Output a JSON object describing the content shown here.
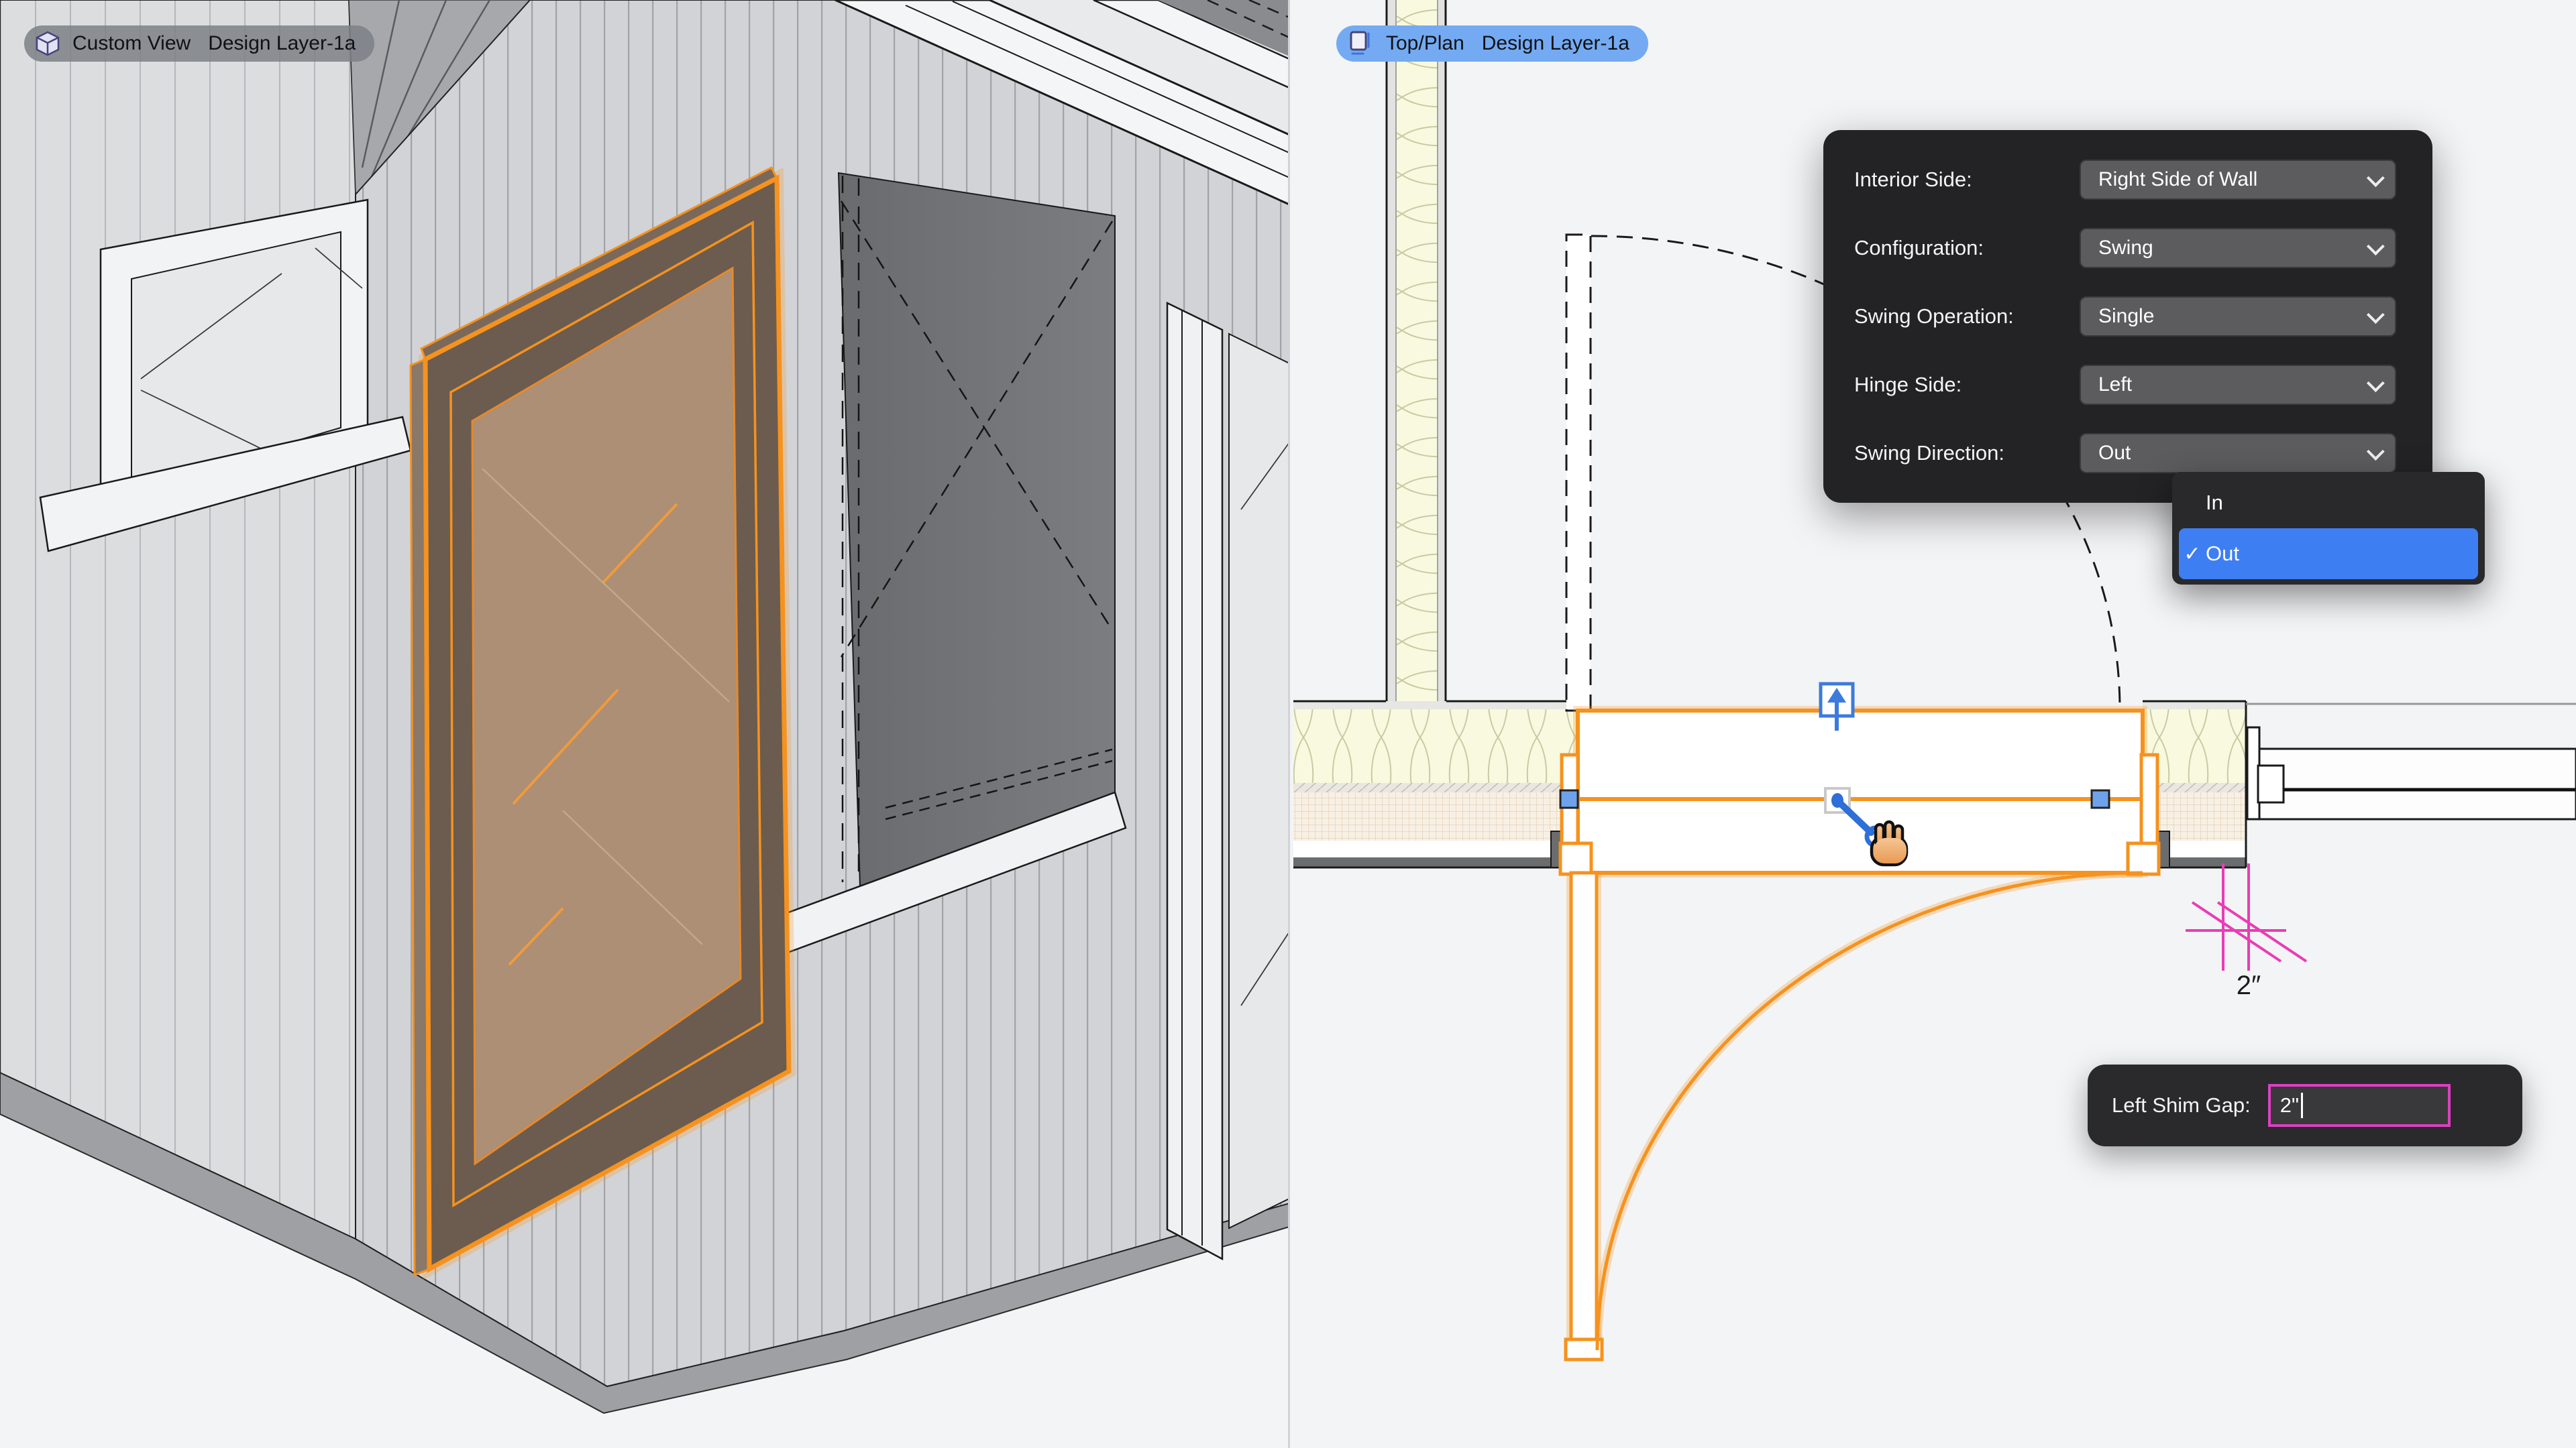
{
  "left_view": {
    "badge": {
      "view_name": "Custom View",
      "layer_name": "Design Layer-1a"
    }
  },
  "right_view": {
    "badge": {
      "view_name": "Top/Plan",
      "layer_name": "Design Layer-1a"
    }
  },
  "door_settings_panel": {
    "rows": [
      {
        "label": "Interior Side:",
        "value": "Right Side of Wall"
      },
      {
        "label": "Configuration:",
        "value": "Swing"
      },
      {
        "label": "Swing Operation:",
        "value": "Single"
      },
      {
        "label": "Hinge Side:",
        "value": "Left"
      },
      {
        "label": "Swing Direction:",
        "value": "Out"
      }
    ]
  },
  "swing_direction_menu": {
    "checkmark": "✓",
    "items": [
      {
        "label": "In",
        "selected": false
      },
      {
        "label": "Out",
        "selected": true
      }
    ]
  },
  "shim_gap_editor": {
    "label": "Left Shim Gap:",
    "value": "2\""
  },
  "plan": {
    "dimension_label": "2″"
  },
  "colors": {
    "selection_orange": "#F6921E",
    "glass_brown": "#B29377",
    "handle_blue": "#2E6FD8",
    "widget_blue": "#3C7BDC",
    "menu_highlight_blue": "#3E7EF3",
    "shim_magenta": "#DE3FC2",
    "dimension_magenta": "#E93DB5",
    "panel_dark": "#232325",
    "insulation_yellow": "#F8F9DF",
    "wall_hatch_beige": "#F8F0E4"
  }
}
